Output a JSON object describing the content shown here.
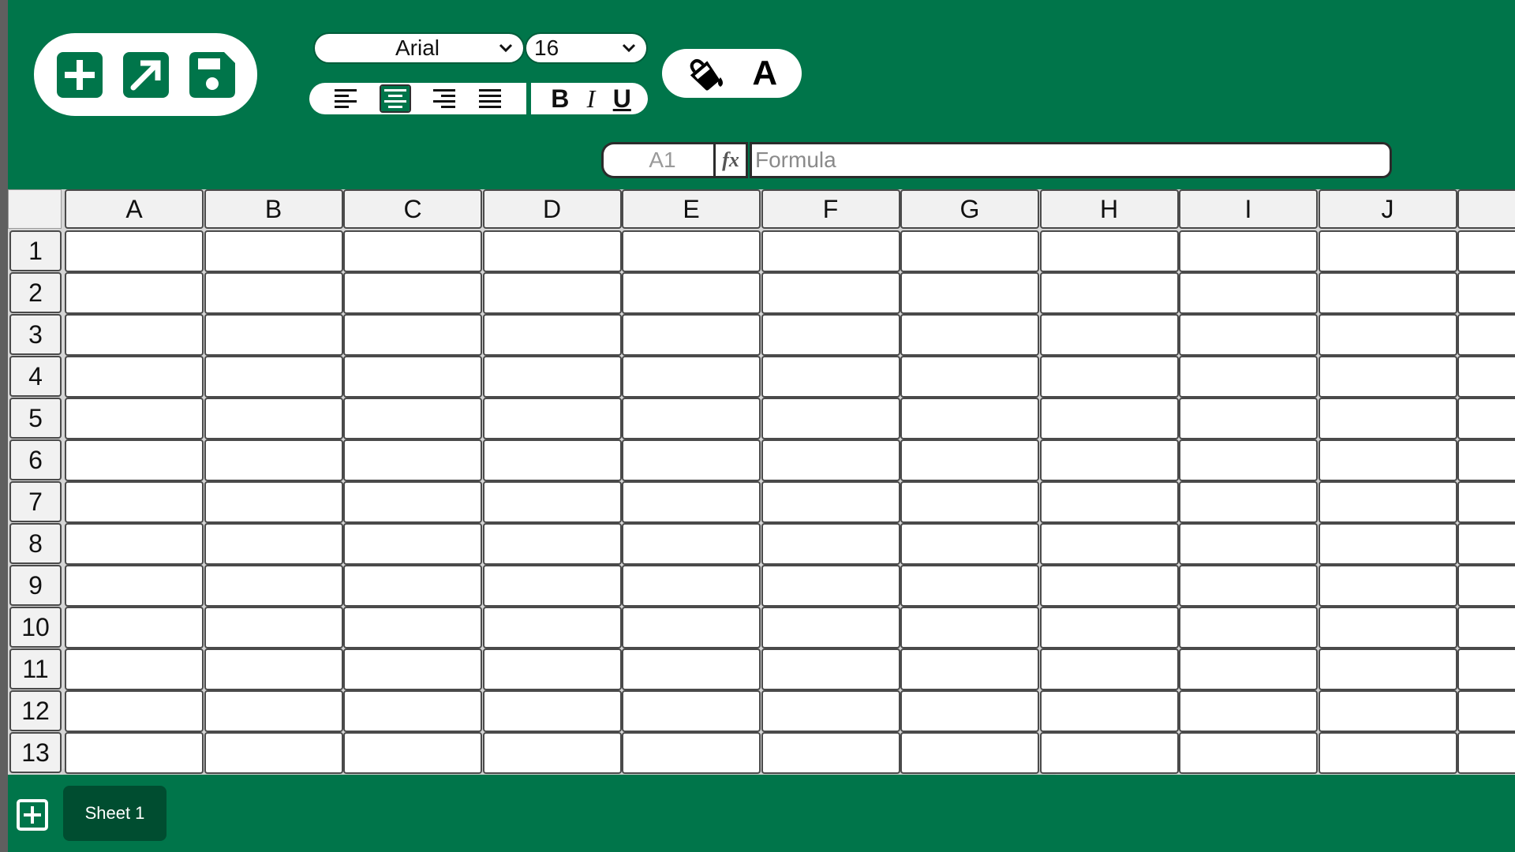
{
  "toolbar": {
    "file_buttons": [
      {
        "icon": "plus-square-icon",
        "title": "New"
      },
      {
        "icon": "arrow-up-right-icon",
        "title": "Open"
      },
      {
        "icon": "save-icon",
        "title": "Save"
      }
    ],
    "font_family": "Arial",
    "font_size": "16",
    "align_buttons": [
      {
        "icon": "align-left-icon",
        "active": false
      },
      {
        "icon": "align-center-icon",
        "active": true
      },
      {
        "icon": "align-right-icon",
        "active": false
      },
      {
        "icon": "align-justify-icon",
        "active": false
      }
    ],
    "style_buttons": [
      {
        "label": "B"
      },
      {
        "label": "I"
      },
      {
        "label": "U"
      }
    ],
    "fill_icon": "paint-bucket-icon",
    "text_color_label": "A"
  },
  "formula_bar": {
    "cell_ref": "A1",
    "fx_label": "fx",
    "formula_placeholder": "Formula"
  },
  "grid": {
    "columns": [
      "A",
      "B",
      "C",
      "D",
      "E",
      "F",
      "G",
      "H",
      "I",
      "J"
    ],
    "rows": [
      "1",
      "2",
      "3",
      "4",
      "5",
      "6",
      "7",
      "8",
      "9",
      "10",
      "11",
      "12",
      "13"
    ]
  },
  "sheets": {
    "add_icon": "plus-square-icon",
    "tabs": [
      "Sheet 1"
    ]
  },
  "colors": {
    "app_bg": "#00754a",
    "active_tab": "#004d30",
    "gutter": "#5f5f5f"
  }
}
